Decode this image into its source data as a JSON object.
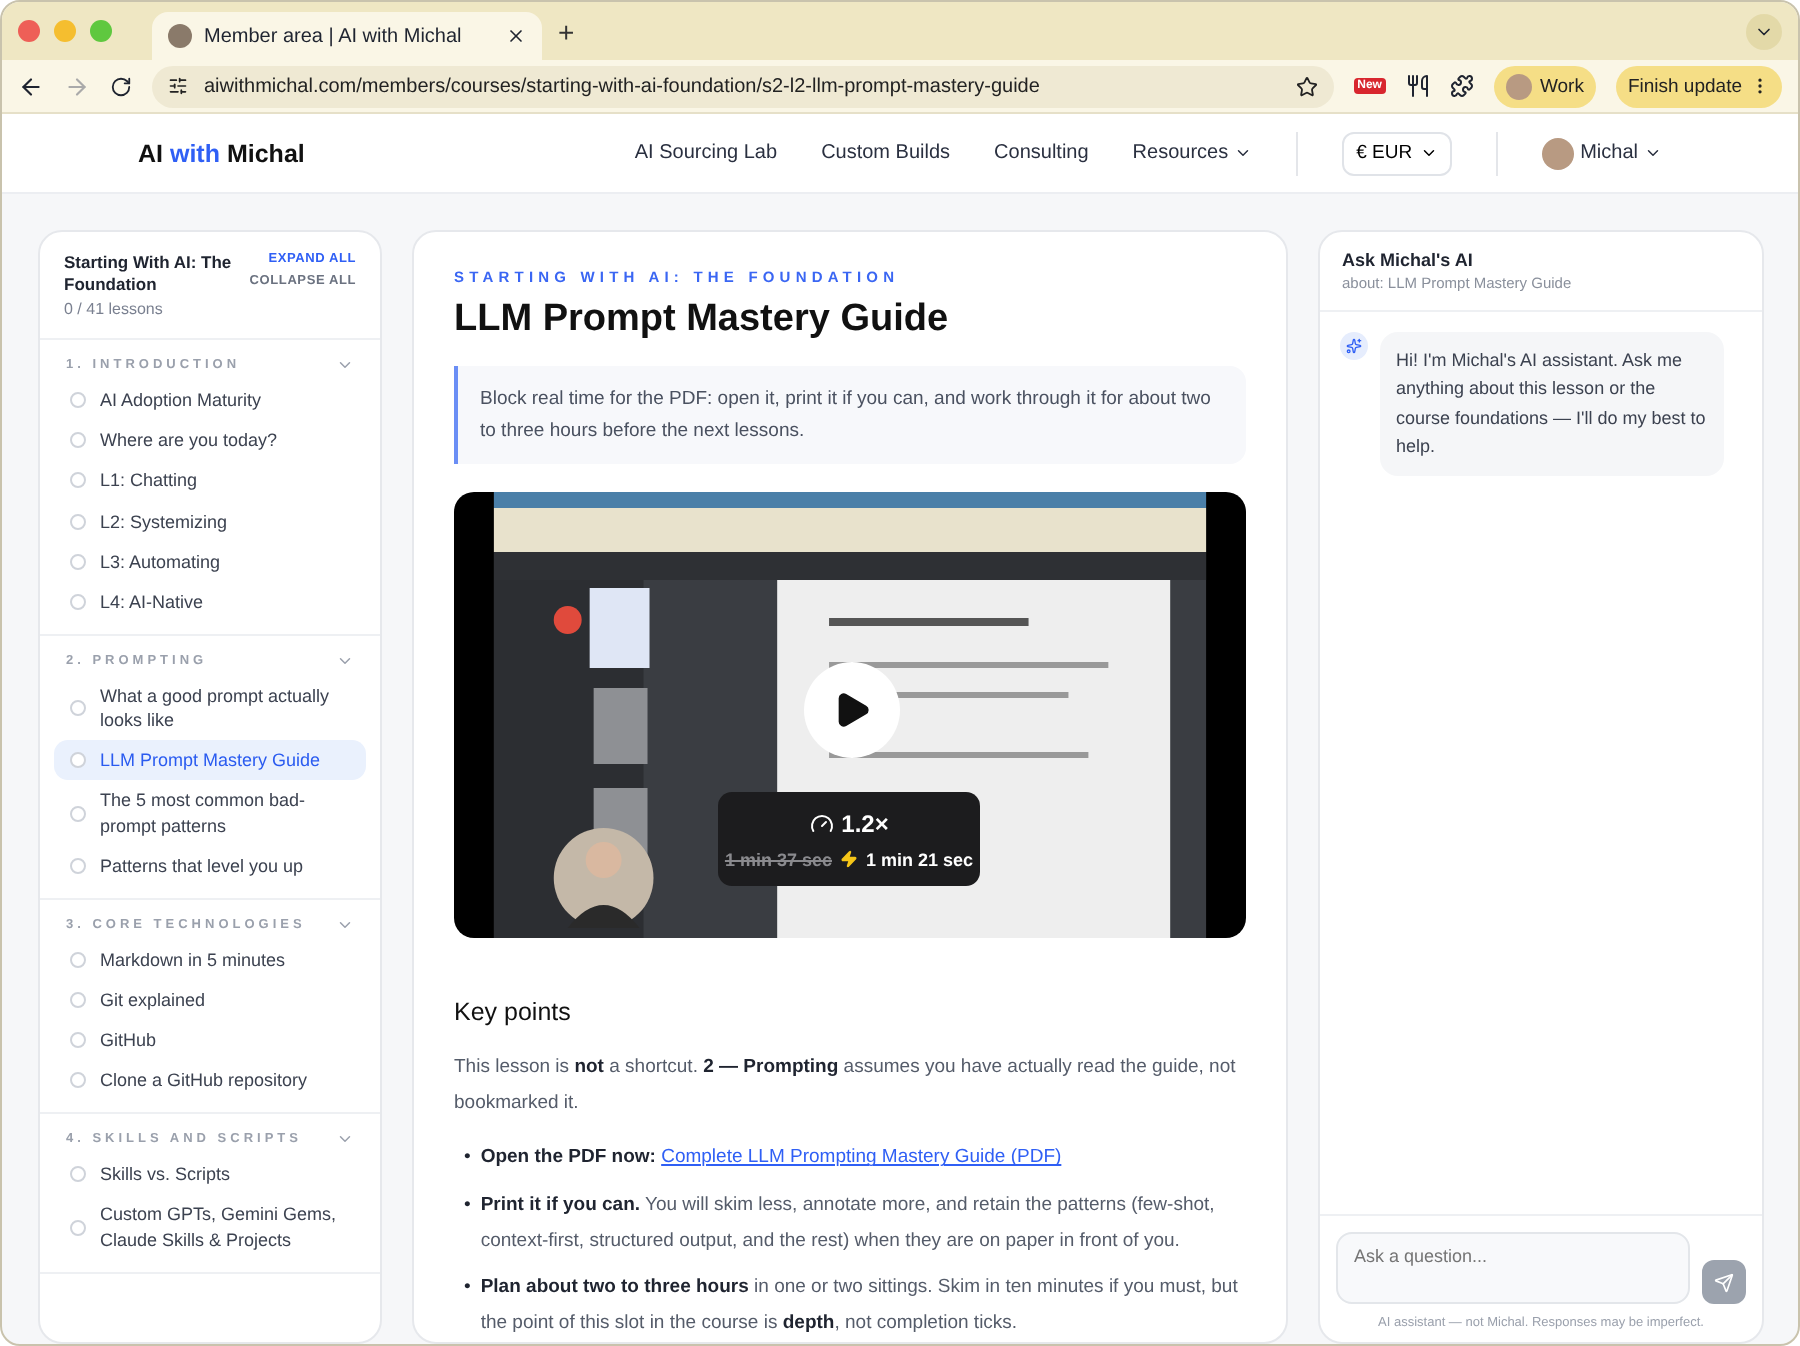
{
  "browser": {
    "tab_title": "Member area | AI with Michal",
    "new_tab": "+",
    "url": "aiwithmichal.com/members/courses/starting-with-ai-foundation/s2-l2-llm-prompt-mastery-guide",
    "extension_badge": "New",
    "profile": "Work",
    "update_button": "Finish update"
  },
  "site": {
    "logo": {
      "first": "AI",
      "accent": "with",
      "last": "Michal"
    },
    "nav": [
      "AI Sourcing Lab",
      "Custom Builds",
      "Consulting"
    ],
    "resources": "Resources",
    "currency": "€ EUR",
    "user": "Michal"
  },
  "sidebar": {
    "course_title": "Starting With AI: The Foundation",
    "progress": "0 / 41 lessons",
    "expand_all": "EXPAND ALL",
    "collapse_all": "COLLAPSE ALL",
    "sections": [
      {
        "title": "1. INTRODUCTION",
        "expanded": true,
        "lessons": [
          {
            "title": "AI Adoption Maturity",
            "selected": false,
            "done": false
          },
          {
            "title": "Where are you today?",
            "selected": false,
            "done": false
          },
          {
            "title": "L1: Chatting",
            "selected": false,
            "done": false
          },
          {
            "title": "L2: Systemizing",
            "selected": false,
            "done": false
          },
          {
            "title": "L3: Automating",
            "selected": false,
            "done": false
          },
          {
            "title": "L4: AI-Native",
            "selected": false,
            "done": false
          }
        ]
      },
      {
        "title": "2. PROMPTING",
        "expanded": true,
        "lessons": [
          {
            "title": "What a good prompt actually looks like",
            "selected": false,
            "done": false
          },
          {
            "title": "LLM Prompt Mastery Guide",
            "selected": true,
            "done": false
          },
          {
            "title": "The 5 most common bad-prompt patterns",
            "selected": false,
            "done": false
          },
          {
            "title": "Patterns that level you up",
            "selected": false,
            "done": false
          }
        ]
      },
      {
        "title": "3. CORE TECHNOLOGIES",
        "expanded": true,
        "lessons": [
          {
            "title": "Markdown in 5 minutes",
            "selected": false,
            "done": false
          },
          {
            "title": "Git explained",
            "selected": false,
            "done": false
          },
          {
            "title": "GitHub",
            "selected": false,
            "done": false
          },
          {
            "title": "Clone a GitHub repository",
            "selected": false,
            "done": false
          }
        ]
      },
      {
        "title": "4. SKILLS AND SCRIPTS",
        "expanded": true,
        "lessons": [
          {
            "title": "Skills vs. Scripts",
            "selected": false,
            "done": false
          },
          {
            "title": "Custom GPTs, Gemini Gems, Claude Skills & Projects",
            "selected": false,
            "done": false
          }
        ]
      }
    ]
  },
  "lesson": {
    "eyebrow": "STARTING WITH AI: THE FOUNDATION",
    "title": "LLM Prompt Mastery Guide",
    "callout": "Block real time for the PDF: open it, print it if you can, and work through it for about two to three hours before the next lessons.",
    "video": {
      "kind": "picture",
      "speed": "1.2×",
      "old_duration": "1 min 37 sec",
      "new_duration": "1 min 21 sec"
    },
    "key_points_heading": "Key points",
    "intro": "This lesson is **not** a shortcut. **2 — Prompting** assumes you have actually read the guide, not bookmarked it.",
    "bullet_marker": "•",
    "bullets": [
      {
        "lead": "Open the PDF now:",
        "link": "Complete LLM Prompting Mastery Guide (PDF)"
      },
      {
        "lead": "Print it if you can.",
        "text": "You will skim less, annotate more, and retain the patterns (few-shot, context-first, structured output, and the rest) when they are on paper in front of you."
      },
      {
        "lead": "Plan about two to three hours",
        "text": "in one or two sittings. Skim in ten minutes if you must, but the point of this slot in the course is **depth**, not completion ticks."
      }
    ]
  },
  "chat": {
    "title": "Ask Michal's AI",
    "subtitle": "about: LLM Prompt Mastery Guide",
    "messages": [
      {
        "text": "Hi! I'm Michal's AI assistant. Ask me anything about this lesson or the course foundations — I'll do my best to help."
      }
    ],
    "placeholder": "Ask a question...",
    "disclaimer": "AI assistant — not Michal. Responses may be imperfect."
  }
}
